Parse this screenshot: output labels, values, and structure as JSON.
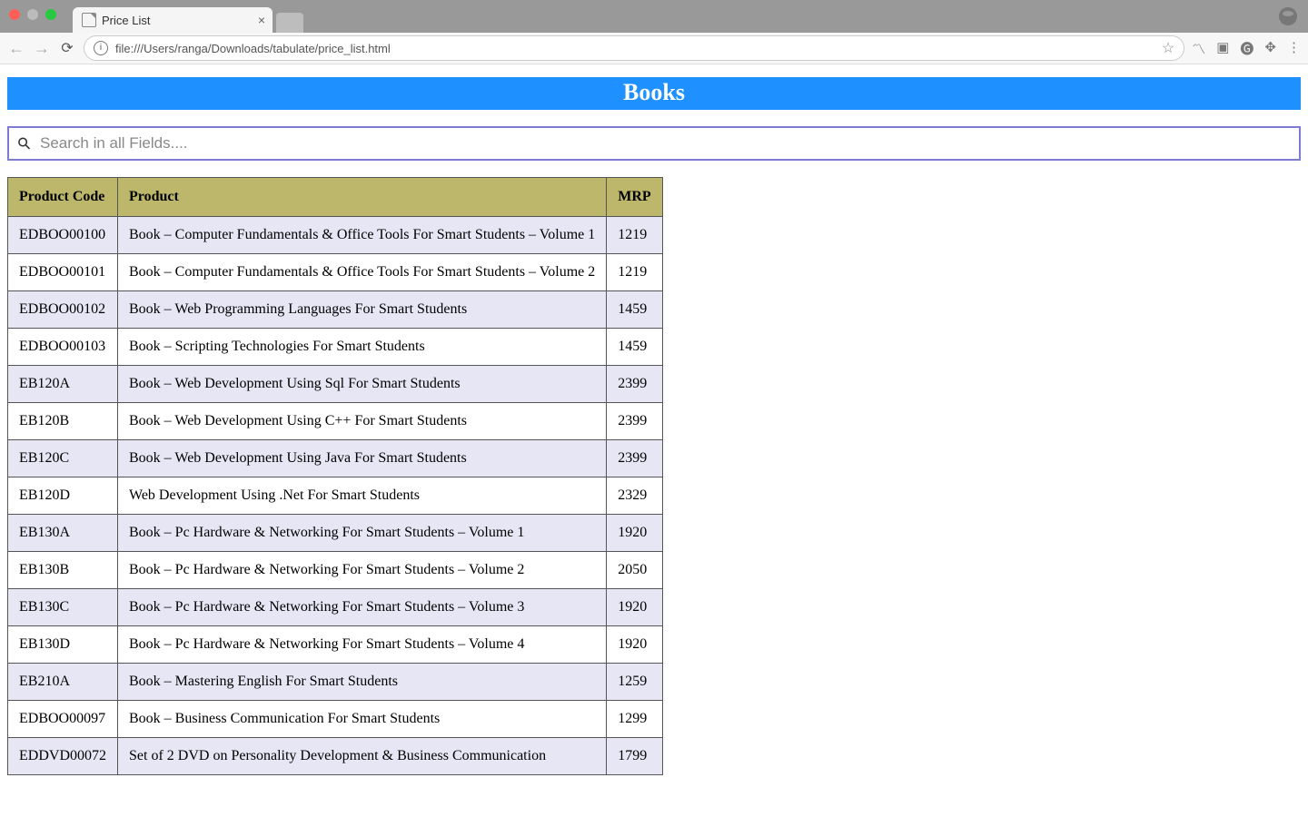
{
  "browser": {
    "tab_title": "Price List",
    "url": "file:///Users/ranga/Downloads/tabulate/price_list.html"
  },
  "page": {
    "banner": "Books",
    "search_placeholder": "Search in all Fields....",
    "columns": {
      "code": "Product Code",
      "product": "Product",
      "mrp": "MRP"
    },
    "rows": [
      {
        "code": "EDBOO00100",
        "product": "Book – Computer Fundamentals & Office Tools For Smart Students – Volume 1",
        "mrp": "1219"
      },
      {
        "code": "EDBOO00101",
        "product": "Book – Computer Fundamentals & Office Tools For Smart Students – Volume 2",
        "mrp": "1219"
      },
      {
        "code": "EDBOO00102",
        "product": "Book – Web Programming Languages For Smart Students",
        "mrp": "1459"
      },
      {
        "code": "EDBOO00103",
        "product": "Book – Scripting Technologies For Smart Students",
        "mrp": "1459"
      },
      {
        "code": "EB120A",
        "product": "Book – Web Development Using Sql For Smart Students",
        "mrp": "2399"
      },
      {
        "code": "EB120B",
        "product": "Book – Web Development Using C++ For Smart Students",
        "mrp": "2399"
      },
      {
        "code": "EB120C",
        "product": "Book – Web Development Using Java For Smart Students",
        "mrp": "2399"
      },
      {
        "code": "EB120D",
        "product": "Web Development Using .Net For Smart Students",
        "mrp": "2329"
      },
      {
        "code": "EB130A",
        "product": "Book – Pc Hardware & Networking For Smart Students – Volume 1",
        "mrp": "1920"
      },
      {
        "code": "EB130B",
        "product": "Book – Pc Hardware & Networking For Smart Students – Volume 2",
        "mrp": "2050"
      },
      {
        "code": "EB130C",
        "product": "Book – Pc Hardware & Networking For Smart Students – Volume 3",
        "mrp": "1920"
      },
      {
        "code": "EB130D",
        "product": "Book – Pc Hardware & Networking For Smart Students – Volume 4",
        "mrp": "1920"
      },
      {
        "code": "EB210A",
        "product": "Book – Mastering English For Smart Students",
        "mrp": "1259"
      },
      {
        "code": "EDBOO00097",
        "product": "Book – Business Communication For Smart Students",
        "mrp": "1299"
      },
      {
        "code": "EDDVD00072",
        "product": "Set of 2 DVD on Personality Development & Business Communication",
        "mrp": "1799"
      }
    ]
  }
}
